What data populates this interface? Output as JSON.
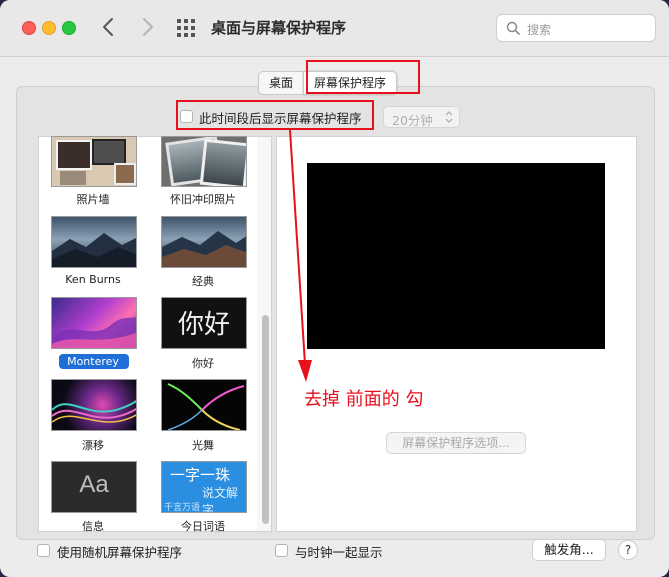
{
  "window": {
    "title": "桌面与屏幕保护程序"
  },
  "search": {
    "placeholder": "搜索"
  },
  "tabs": [
    {
      "label": "桌面",
      "selected": false
    },
    {
      "label": "屏幕保护程序",
      "selected": true
    }
  ],
  "delay": {
    "checkbox_label": "此时间段后显示屏幕保护程序",
    "checked": false,
    "select_value": "20分钟"
  },
  "screensavers": [
    {
      "label": "照片墙",
      "selected": false
    },
    {
      "label": "怀旧冲印照片",
      "selected": false
    },
    {
      "label": "Ken Burns",
      "selected": false
    },
    {
      "label": "经典",
      "selected": false
    },
    {
      "label": "Monterey",
      "selected": true
    },
    {
      "label": "你好",
      "selected": false
    },
    {
      "label": "漂移",
      "selected": false
    },
    {
      "label": "光舞",
      "selected": false
    },
    {
      "label": "信息",
      "selected": false
    },
    {
      "label": "今日词语",
      "selected": false
    }
  ],
  "thumb_text": {
    "hello": "你好",
    "info": "Aa",
    "word_line1": "一字一珠",
    "word_line2": "说文解字",
    "word_line3": "千言万语"
  },
  "annotation": {
    "text": "去掉  前面的  勾"
  },
  "options_button": {
    "label": "屏幕保护程序选项..."
  },
  "bottom": {
    "random_label": "使用随机屏幕保护程序",
    "clock_label": "与时钟一起显示",
    "hot_corners_label": "触发角...",
    "help_label": "?"
  },
  "colors": {
    "annotation_red": "#e8111b",
    "selection_blue": "#1f6fd6"
  }
}
